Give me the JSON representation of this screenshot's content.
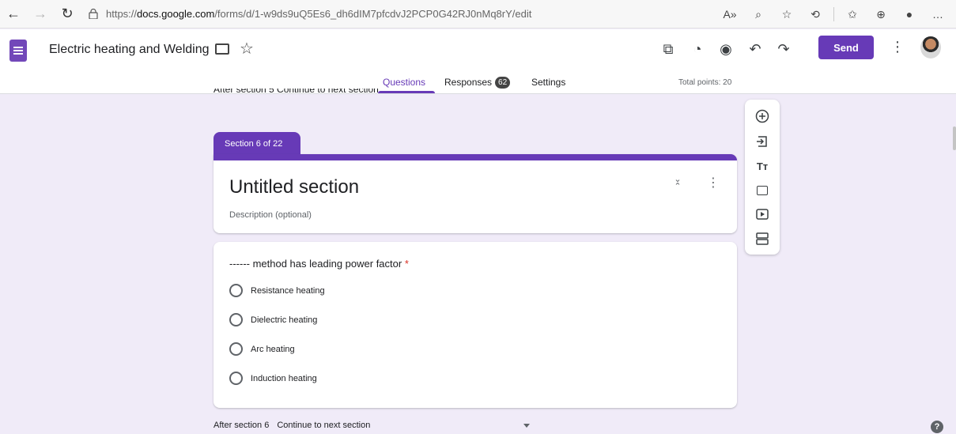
{
  "browser": {
    "url_prefix": "https://",
    "url_host": "docs.google.com",
    "url_path": "/forms/d/1-w9ds9uQ5Es6_dh6dIM7pfcdvJ2PCP0G42RJ0nMq8rY/edit"
  },
  "header": {
    "doc_title": "Electric heating and Welding",
    "send_label": "Send",
    "tabs": [
      {
        "label": "Questions",
        "active": true
      },
      {
        "label": "Responses",
        "badge": "62"
      },
      {
        "label": "Settings"
      }
    ],
    "total_points": "Total points: 20"
  },
  "content": {
    "cut_text": "After section 5   Continue to next section",
    "section_tab": "Section 6 of 22",
    "section_title": "Untitled section",
    "section_description": "Description (optional)",
    "question": {
      "title": "------ method has leading power factor",
      "required_mark": "*",
      "options": [
        "Resistance heating",
        "Dielectric heating",
        "Arc heating",
        "Induction heating"
      ]
    },
    "after_section_label": "After section 6",
    "after_section_value": "Continue to next section"
  },
  "colors": {
    "accent": "#673ab7",
    "background": "#f0ebf8"
  }
}
